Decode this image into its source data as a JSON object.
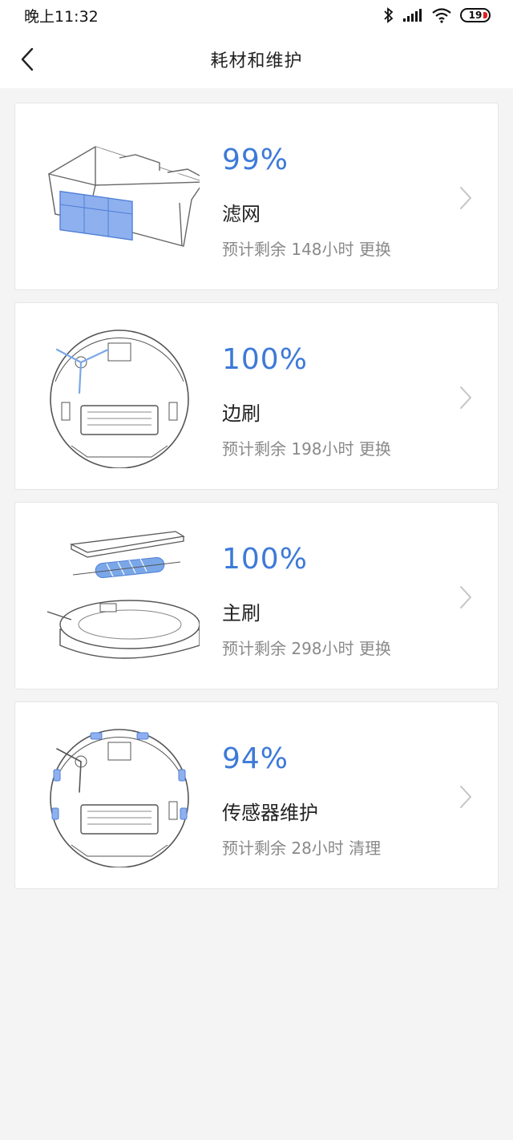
{
  "status_bar": {
    "time": "晚上11:32",
    "battery_level": "19",
    "battery_color": "#e02020"
  },
  "header": {
    "title": "耗材和维护",
    "back_icon": "chevron-left-icon"
  },
  "accent_color": "#3d7ad8",
  "consumables": [
    {
      "percent": "99%",
      "name": "滤网",
      "remaining": "预计剩余 148小时 更换"
    },
    {
      "percent": "100%",
      "name": "边刷",
      "remaining": "预计剩余 198小时 更换"
    },
    {
      "percent": "100%",
      "name": "主刷",
      "remaining": "预计剩余 298小时 更换"
    },
    {
      "percent": "94%",
      "name": "传感器维护",
      "remaining": "预计剩余 28小时 清理"
    }
  ]
}
